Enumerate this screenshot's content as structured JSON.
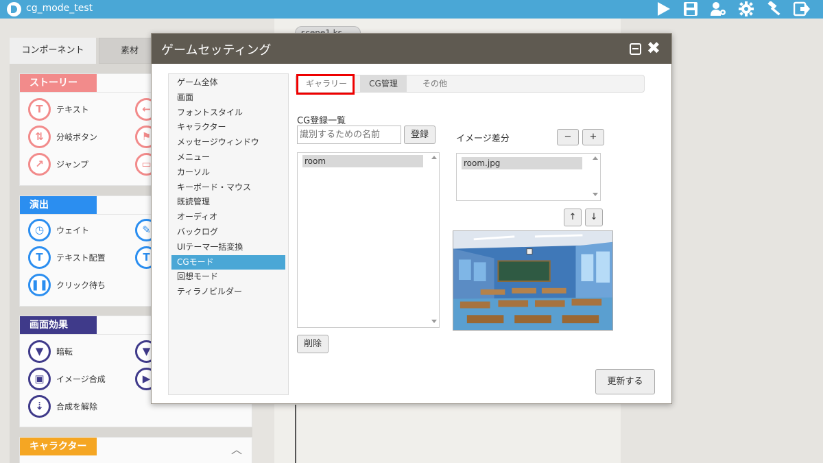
{
  "app": {
    "title": "cg_mode_test"
  },
  "toolbar": {
    "icons": [
      "play-icon",
      "save-icon",
      "user-settings-icon",
      "gear-icon",
      "hammer-icon",
      "export-icon"
    ]
  },
  "left_panel": {
    "tabs": [
      "コンポーネント",
      "素材"
    ],
    "sections": [
      {
        "name": "ストーリー",
        "color": "#f28b8b",
        "items": [
          "テキスト",
          "分岐ボタン",
          "ジャンプ"
        ]
      },
      {
        "name": "演出",
        "color": "#2b8ef0",
        "items": [
          "ウェイト",
          "テキスト配置",
          "クリック待ち"
        ]
      },
      {
        "name": "画面効果",
        "color": "#3f3a8a",
        "items": [
          "暗転",
          "イメージ合成",
          "合成を解除"
        ]
      },
      {
        "name": "キャラクター",
        "color": "#f5a623",
        "items": []
      }
    ]
  },
  "editor": {
    "scene_tab": "scene1.ks"
  },
  "modal": {
    "title": "ゲームセッティング",
    "settings_items": [
      "ゲーム全体",
      "画面",
      "フォントスタイル",
      "キャラクター",
      "メッセージウィンドウ",
      "メニュー",
      "カーソル",
      "キーボード・マウス",
      "既読管理",
      "オーディオ",
      "バックログ",
      "UIテーマ一括変換",
      "CGモード",
      "回想モード",
      "ティラノビルダー"
    ],
    "active_setting": "CGモード",
    "tabs": {
      "gallery": "ギャラリー",
      "cg": "CG管理",
      "other": "その他"
    },
    "cg_list_label": "CG登録一覧",
    "name_placeholder": "識別するための名前",
    "register_label": "登録",
    "cg_items": [
      "room"
    ],
    "delete_label": "削除",
    "image_diff_label": "イメージ差分",
    "minus_label": "−",
    "plus_label": "+",
    "diff_items": [
      "room.jpg"
    ],
    "up_label": "↑",
    "down_label": "↓",
    "update_label": "更新する"
  }
}
